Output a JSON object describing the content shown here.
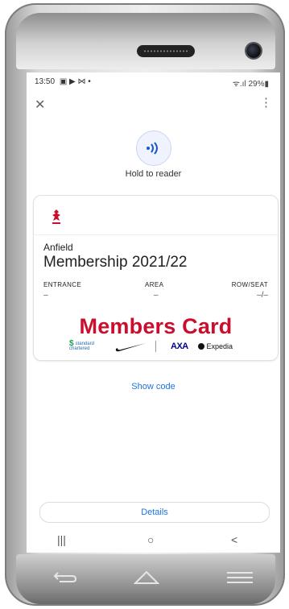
{
  "status_bar": {
    "time": "13:50",
    "indicators": "▣ ▶ ⋈ •",
    "signal": "ᯤ.ıl",
    "battery": "29%▮"
  },
  "header": {
    "close_icon": "close-icon",
    "menu_icon": "more-vert-icon"
  },
  "nfc": {
    "label": "Hold to reader"
  },
  "card": {
    "venue": "Anfield",
    "title": "Membership 2021/22",
    "fields": [
      {
        "label": "ENTRANCE",
        "value": "–"
      },
      {
        "label": "AREA",
        "value": "–"
      },
      {
        "label": "ROW/SEAT",
        "value": "–/–"
      }
    ],
    "banner": "Members Card",
    "sponsors": [
      "standard chartered",
      "AXA",
      "Expedia"
    ],
    "colors": {
      "banner": "#c8102e",
      "crest": "#c8102e"
    }
  },
  "actions": {
    "show_code": "Show code",
    "details": "Details"
  },
  "nav": {
    "recents": "|||",
    "home": "○",
    "back": "<"
  }
}
